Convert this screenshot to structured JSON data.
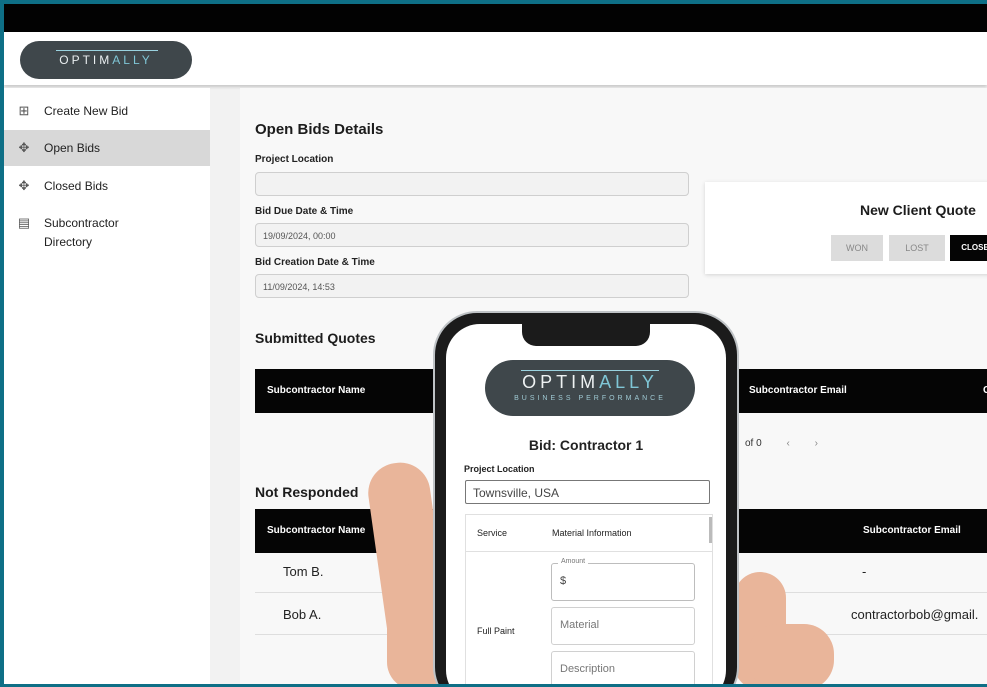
{
  "header": {
    "logo_main": "OPTIM",
    "logo_accent": "ALLY"
  },
  "sidebar": {
    "items": [
      {
        "label": "Create New Bid",
        "icon": "plus-square-icon"
      },
      {
        "label": "Open Bids",
        "icon": "move-arrows-icon"
      },
      {
        "label": "Closed Bids",
        "icon": "move-arrows-icon"
      },
      {
        "label": "Subcontractor",
        "label2": "Directory",
        "icon": "clipboard-icon"
      }
    ]
  },
  "main": {
    "title": "Open Bids Details",
    "project_location_label": "Project Location",
    "project_location_value": "",
    "due_label": "Bid Due Date & Time",
    "due_value": "19/09/2024, 00:00",
    "created_label": "Bid Creation Date & Time",
    "created_value": "11/09/2024, 14:53",
    "client_quote": {
      "title": "New Client Quote",
      "won": "WON",
      "lost": "LOST",
      "close": "CLOSE"
    },
    "submitted": {
      "title": "Submitted Quotes",
      "col_name": "Subcontractor Name",
      "col_email": "Subcontractor Email",
      "col_extra": "C",
      "pagination": "of 0",
      "prev": "‹",
      "next": "›"
    },
    "not_responded": {
      "title": "Not Responded",
      "col_name": "Subcontractor Name",
      "col_email": "Subcontractor Email",
      "rows": [
        {
          "name": "Tom B.",
          "email": "-"
        },
        {
          "name": "Bob A.",
          "email": "contractorbob@gmail."
        }
      ]
    }
  },
  "phone": {
    "logo_main": "OPTIM",
    "logo_accent": "ALLY",
    "logo_sub": "BUSINESS PERFORMANCE",
    "title": "Bid: Contractor 1",
    "project_location_label": "Project Location",
    "project_location_value": "Townsville, USA",
    "col_service": "Service",
    "col_material": "Material Information",
    "service": "Full Paint",
    "amount_label": "Amount",
    "amount_value": "$",
    "material_placeholder": "Material",
    "description_placeholder": "Description"
  },
  "colors": {
    "border": "#0e6f86",
    "accent": "#7fc6d6",
    "header_dark": "#050505"
  }
}
